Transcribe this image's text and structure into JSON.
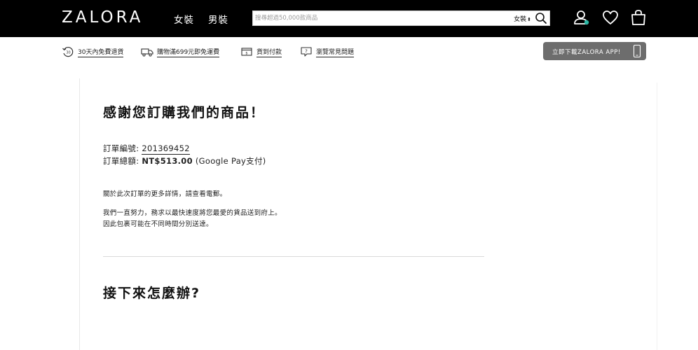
{
  "header": {
    "logo": "ZALORA",
    "nav": {
      "women": "女裝",
      "men": "男裝"
    },
    "search": {
      "placeholder": "搜尋超過50,000款商品",
      "category": "女裝",
      "category_arrow": "⬍"
    },
    "colors": {
      "background": "#000000",
      "account_badge": "#2bb7a5"
    }
  },
  "benefits": [
    {
      "icon": "return-30-icon",
      "label": "30天內免費退貨"
    },
    {
      "icon": "truck-icon",
      "label": "購物滿699元即免運費"
    },
    {
      "icon": "cash-on-delivery-icon",
      "label": "貨到付款"
    },
    {
      "icon": "question-bubble-icon",
      "label": "瀏覽常見問題"
    }
  ],
  "app_button": {
    "label": "立即下載ZALORA APP!",
    "icon": "phone-icon"
  },
  "confirmation": {
    "title": "感謝您訂購我們的商品！",
    "order_label": "訂單編號:",
    "order_number": "201369452",
    "total_label": "訂單總額:",
    "total_amount": "NT$513.00",
    "payment_note": "(Google Pay支付)",
    "paragraphs": [
      "關於此次訂單的更多詳情，請查看電郵。",
      "我們一直努力，務求以最快速度將您最愛的貨品送到府上。",
      "因此包裹可能在不同時間分別送達。"
    ],
    "next_title": "接下來怎麼辦?"
  }
}
